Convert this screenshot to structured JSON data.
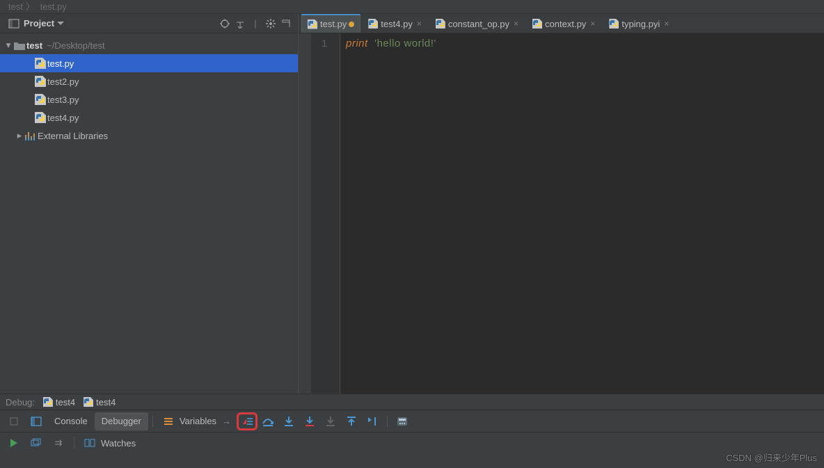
{
  "breadcrumb": {
    "seg1": "test",
    "seg2": "test.py"
  },
  "sidebar": {
    "title": "Project",
    "root": {
      "name": "test",
      "path": "~/Desktop/test"
    },
    "files": [
      "test.py",
      "test2.py",
      "test3.py",
      "test4.py"
    ],
    "external": "External Libraries"
  },
  "tabs": [
    {
      "label": "test.py",
      "active": true,
      "dirty": true
    },
    {
      "label": "test4.py",
      "active": false,
      "close": true
    },
    {
      "label": "constant_op.py",
      "active": false,
      "close": true
    },
    {
      "label": "context.py",
      "active": false,
      "close": true
    },
    {
      "label": "typing.pyi",
      "active": false,
      "close": true
    }
  ],
  "code": {
    "line": "1",
    "keyword": "print",
    "string": "'hello world!'"
  },
  "debug": {
    "label": "Debug:",
    "cfg1": "test4",
    "cfg2": "test4"
  },
  "bottom": {
    "console": "Console",
    "debugger": "Debugger",
    "variables": "Variables",
    "arrow": "→",
    "watches": "Watches"
  },
  "watermark": "CSDN @归来少年Plus"
}
